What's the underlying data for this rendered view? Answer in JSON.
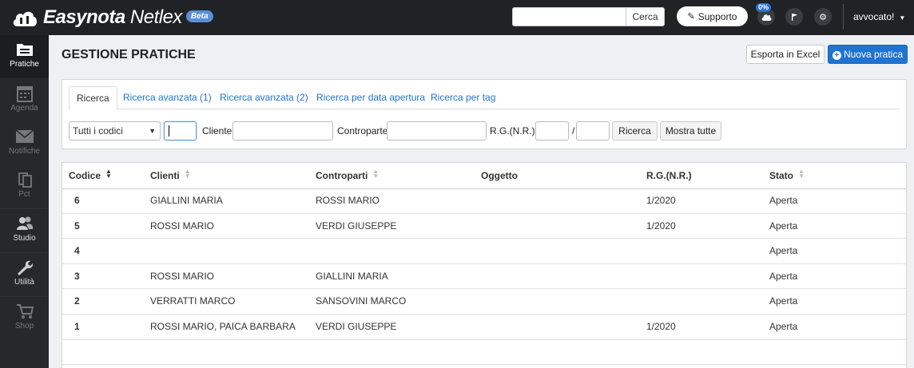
{
  "brand": {
    "name_bold": "Easynota",
    "name_thin": "Netlex",
    "badge": "Beta"
  },
  "topbar": {
    "search_placeholder": "",
    "search_button": "Cerca",
    "support_button": "Supporto",
    "sync_percent": "0%",
    "user": "avvocato!"
  },
  "sidebar": {
    "items": [
      {
        "label": "Pratiche",
        "icon": "folder-icon",
        "active": true
      },
      {
        "label": "Agenda",
        "icon": "calendar-icon"
      },
      {
        "label": "Notifiche",
        "icon": "envelope-icon"
      },
      {
        "label": "Pct",
        "icon": "documents-icon"
      },
      {
        "label": "Studio",
        "icon": "users-icon"
      },
      {
        "label": "Utilità",
        "icon": "wrench-icon"
      },
      {
        "label": "Shop",
        "icon": "cart-icon"
      }
    ]
  },
  "page": {
    "title": "GESTIONE PRATICHE",
    "export_button": "Esporta in Excel",
    "new_button": "Nuova pratica"
  },
  "search": {
    "tabs": [
      "Ricerca",
      "Ricerca avanzata (1)",
      "Ricerca avanzata (2)",
      "Ricerca per data apertura",
      "Ricerca per tag"
    ],
    "code_select": "Tutti i codici",
    "cliente_label": "Cliente:",
    "controparte_label": "Controparte:",
    "rg_label": "R.G.(N.R.):",
    "rg_sep": "/",
    "search_button": "Ricerca",
    "show_all_button": "Mostra tutte"
  },
  "table": {
    "columns": [
      "Codice",
      "Clienti",
      "Controparti",
      "Oggetto",
      "R.G.(N.R.)",
      "Stato"
    ],
    "rows": [
      {
        "codice": "6",
        "clienti": "GIALLINI MARIA",
        "controparti": "ROSSI MARIO",
        "oggetto": "",
        "rg": "1/2020",
        "stato": "Aperta"
      },
      {
        "codice": "5",
        "clienti": "ROSSI MARIO",
        "controparti": "VERDI GIUSEPPE",
        "oggetto": "",
        "rg": "1/2020",
        "stato": "Aperta"
      },
      {
        "codice": "4",
        "clienti": "",
        "controparti": "",
        "oggetto": "",
        "rg": "",
        "stato": "Aperta"
      },
      {
        "codice": "3",
        "clienti": "ROSSI MARIO",
        "controparti": "GIALLINI MARIA",
        "oggetto": "",
        "rg": "",
        "stato": "Aperta"
      },
      {
        "codice": "2",
        "clienti": "VERRATTI MARCO",
        "controparti": "SANSOVINI MARCO",
        "oggetto": "",
        "rg": "",
        "stato": "Aperta"
      },
      {
        "codice": "1",
        "clienti": "ROSSI MARIO, PAICA BARBARA",
        "controparti": "VERDI GIUSEPPE",
        "oggetto": "",
        "rg": "1/2020",
        "stato": "Aperta"
      }
    ]
  }
}
